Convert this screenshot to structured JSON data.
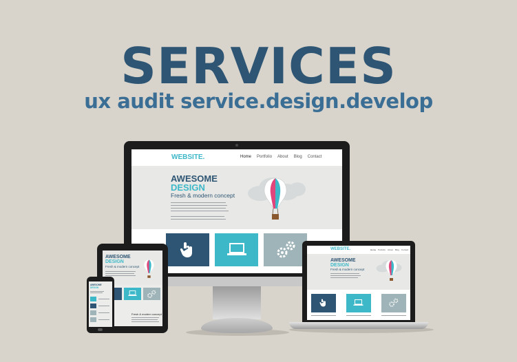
{
  "headline": "SERVICES",
  "tagline": "ux audit service.design.develop",
  "website": {
    "logo": "WEBSITE.",
    "nav": [
      "Home",
      "Portfolio",
      "About",
      "Blog",
      "Contact"
    ],
    "hero_title_1": "AWESOME",
    "hero_title_2": "DESIGN",
    "hero_subtitle": "Fresh & modern concept"
  },
  "phone_screen": {
    "hero_subtitle": "Fresh & modern concept"
  },
  "colors": {
    "background": "#d9d4cb",
    "navy": "#2e5573",
    "teal": "#3db8c9",
    "grey_tile": "#9fb4b8"
  },
  "icons": [
    "hand-pointer-icon",
    "laptop-icon",
    "gears-icon",
    "hot-air-balloon-icon",
    "cloud-icon"
  ]
}
